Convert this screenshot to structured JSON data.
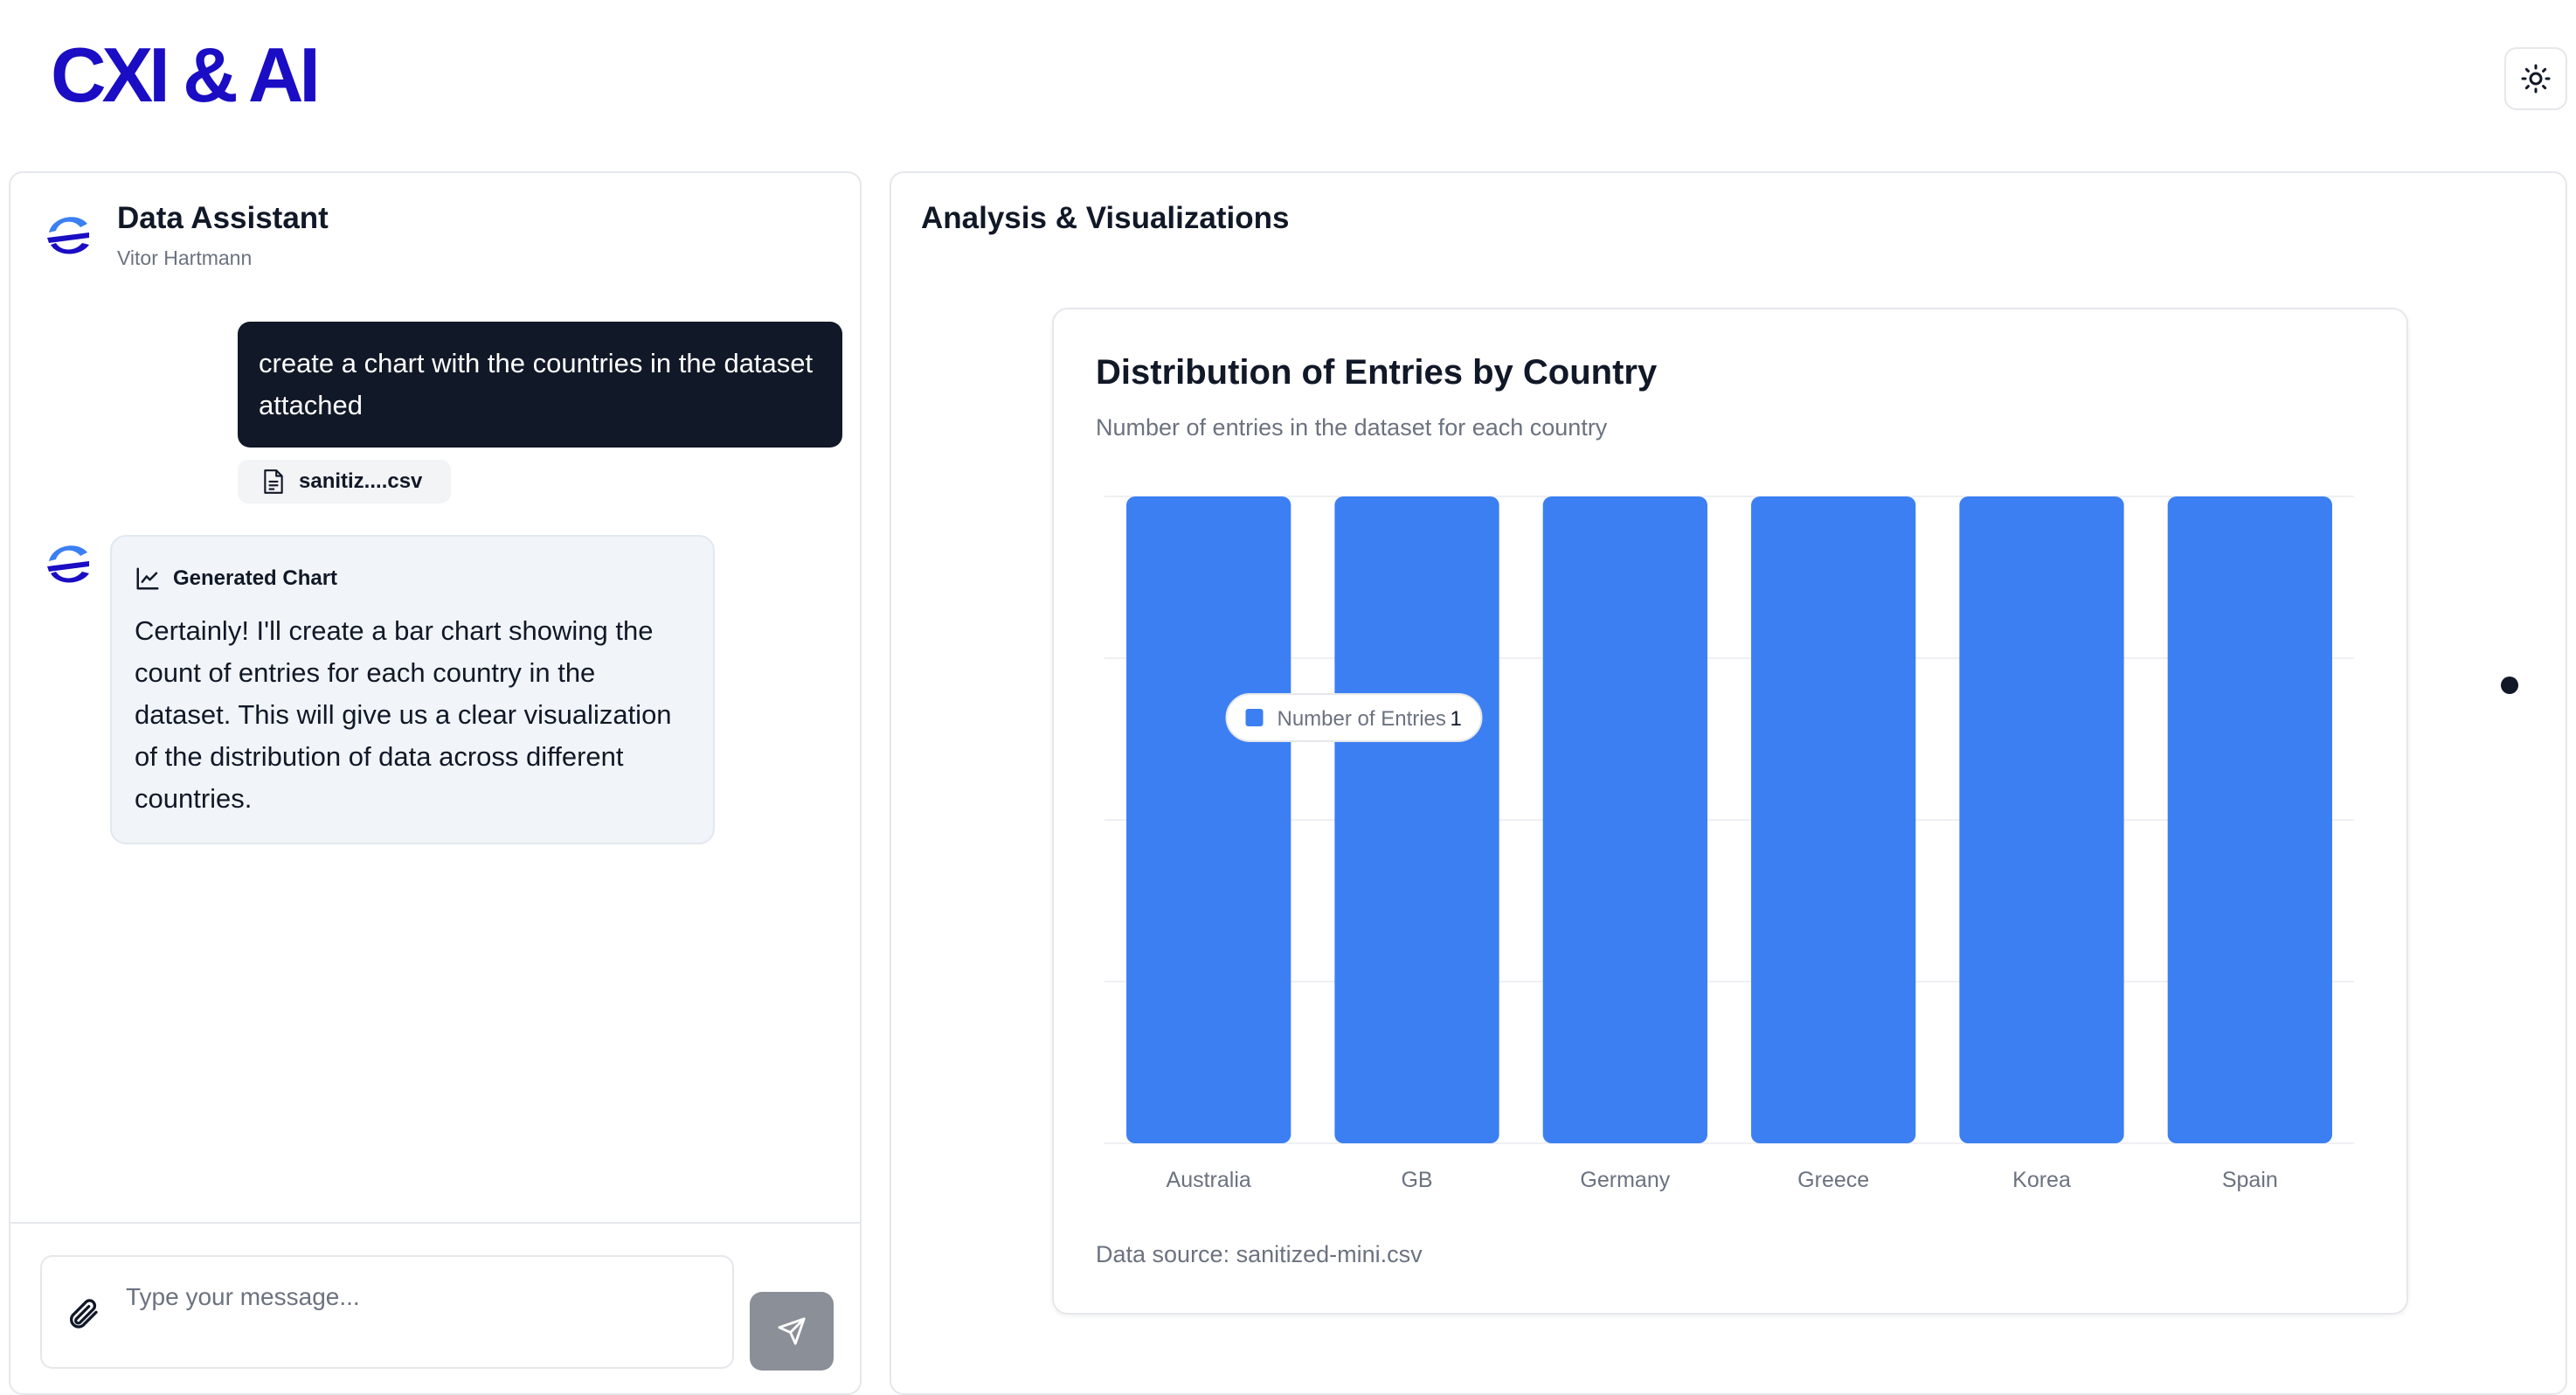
{
  "header": {
    "logo_text": "CXI & AI",
    "theme_toggle_icon": "sun-icon"
  },
  "chat": {
    "title": "Data Assistant",
    "subtitle": "Vitor Hartmann",
    "user_message": "create a chart with the countries in the dataset attached",
    "attachment_name": "sanitiz....csv",
    "assistant_label": "Generated Chart",
    "assistant_message": "Certainly! I'll create a bar chart showing the count of entries for each country in the dataset. This will give us a clear visualization of the distribution of data across different countries.",
    "input_placeholder": "Type your message...",
    "input_value": ""
  },
  "viz": {
    "title": "Analysis & Visualizations",
    "source": "Data source: sanitized-mini.csv"
  },
  "colors": {
    "brand": "#1a0dc4",
    "bar": "#3b7ff2",
    "user_bubble": "#111827",
    "assistant_bubble": "#f1f5f9"
  },
  "chart_data": {
    "type": "bar",
    "title": "Distribution of Entries by Country",
    "subtitle": "Number of entries in the dataset for each country",
    "categories": [
      "Australia",
      "GB",
      "Germany",
      "Greece",
      "Korea",
      "Spain"
    ],
    "series": [
      {
        "name": "Number of Entries",
        "values": [
          1,
          1,
          1,
          1,
          1,
          1
        ]
      }
    ],
    "ylim": [
      0,
      1
    ],
    "grid": true,
    "tooltip": {
      "category": "GB",
      "series": "Number of Entries",
      "value": "1"
    }
  }
}
